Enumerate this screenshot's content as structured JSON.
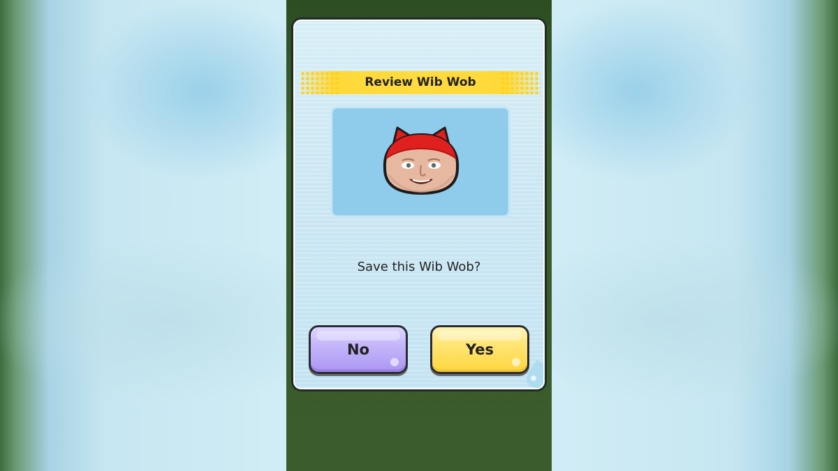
{
  "dialog": {
    "title": "Review Wib Wob",
    "question": "Save this Wib Wob?",
    "no_label": "No",
    "yes_label": "Yes"
  },
  "colors": {
    "title_bar": "#fedb3e",
    "no_button": "#c7b9fb",
    "yes_button": "#ffe679",
    "dialog_bg": "#cbe7f3",
    "preview_bg": "#8fcbea"
  },
  "icons": {
    "avatar": "wib-wob-face-icon",
    "corner_decoration": "water-drop-icon"
  }
}
